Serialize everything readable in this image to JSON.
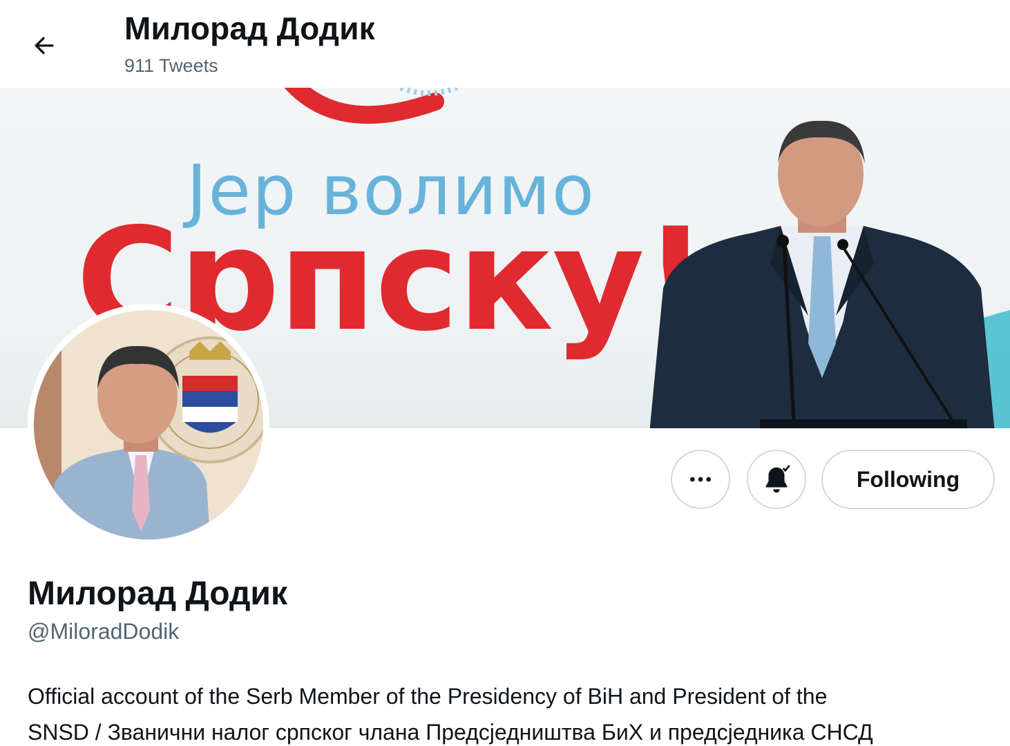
{
  "header": {
    "title": "Милорад Додик",
    "tweet_count": "911 Tweets"
  },
  "banner": {
    "line1": "Јер волимо",
    "line2": "Српску!"
  },
  "actions": {
    "more_icon": "more-horizontal-icon",
    "notify_icon": "bell-subscribed-icon",
    "following_label": "Following"
  },
  "profile": {
    "name": "Милорад Додик",
    "handle": "@MiloradDodik",
    "bio_line1": "Official account of the Serb Member of the Presidency of BiH and President of the",
    "bio_line2": "SNSD / Званични налог српског члана Предсједништва БиХ и предсједника СНСД"
  },
  "colors": {
    "text_primary": "#0f1419",
    "text_secondary": "#536471",
    "border": "#cfd9de",
    "banner_red": "#df2a2f",
    "banner_blue": "#4fa8d6"
  }
}
